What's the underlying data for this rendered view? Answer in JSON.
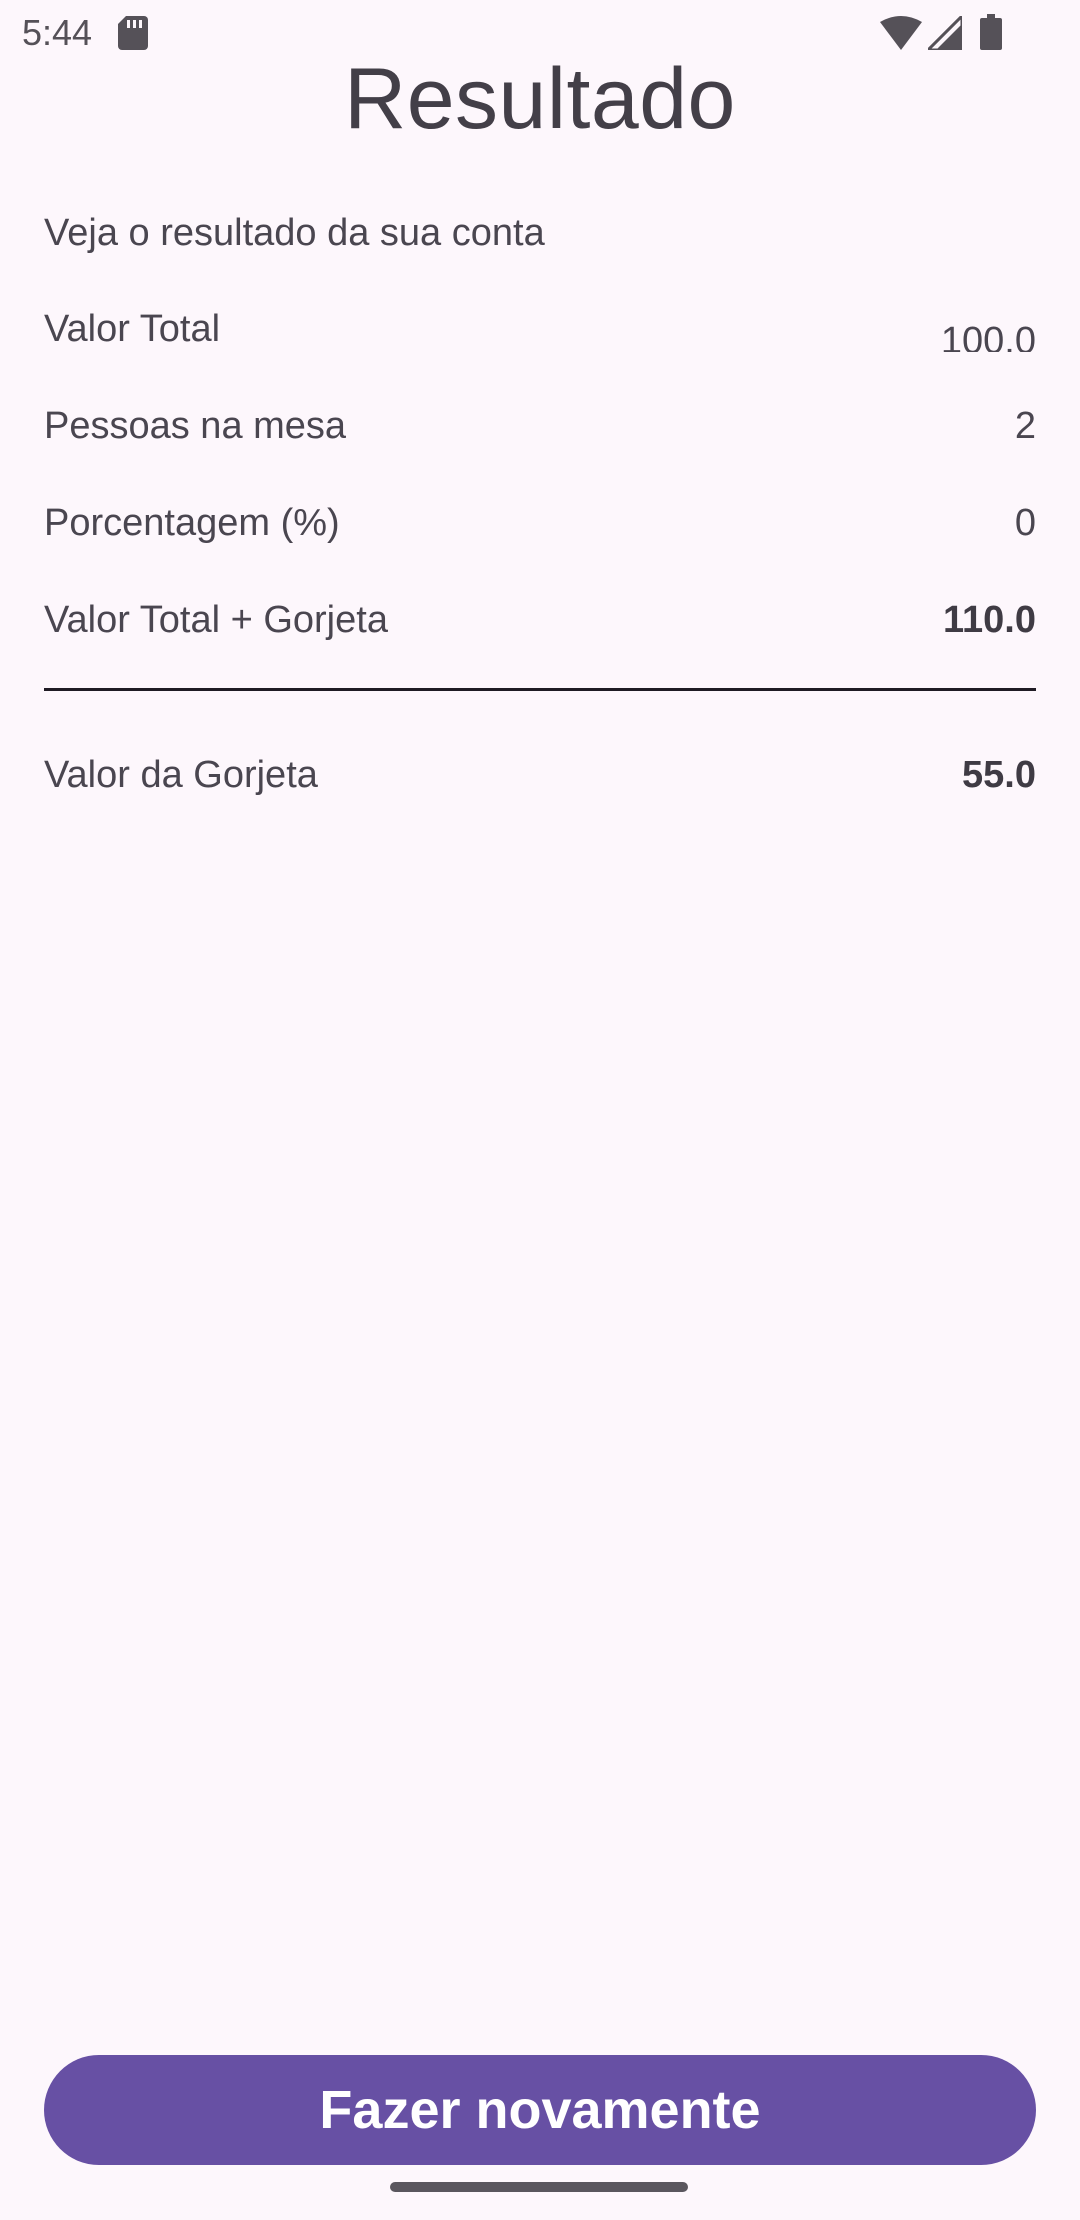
{
  "status_bar": {
    "time": "5:44",
    "icons": [
      "sd-card-icon",
      "wifi-icon",
      "signal-icon",
      "battery-icon"
    ]
  },
  "header": {
    "title": "Resultado"
  },
  "main": {
    "subtitle": "Veja o resultado da sua conta",
    "rows": [
      {
        "label": "Valor Total",
        "value": "100.0"
      },
      {
        "label": "Pessoas na mesa",
        "value": "2"
      },
      {
        "label": "Porcentagem (%)",
        "value": "0"
      },
      {
        "label": "Valor Total + Gorjeta",
        "value": "110.0"
      }
    ],
    "tip": {
      "label": "Valor da Gorjeta",
      "value": "55.0"
    }
  },
  "actions": {
    "redo_label": "Fazer novamente"
  },
  "colors": {
    "background": "#FDF7FC",
    "primary": "#6750A4",
    "text": "#4A4650"
  }
}
